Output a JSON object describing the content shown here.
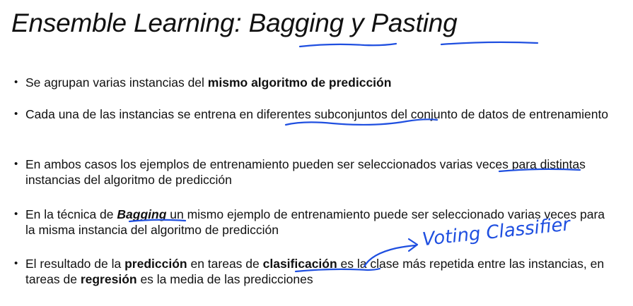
{
  "title": {
    "part1": "Ensemble Learning",
    "sep": ": ",
    "part2": "Bagging",
    "mid": " y ",
    "part3": "Pasting"
  },
  "bullets": [
    {
      "a": "Se agrupan varias instancias del ",
      "b": "mismo algoritmo de predicción"
    },
    {
      "a": "Cada una de las instancias se entrena en diferentes subconjuntos del conjunto de datos de entrenamiento"
    },
    {
      "a": "En ambos casos los ejemplos de entrenamiento pueden ser seleccionados varias veces para distintas instancias del algoritmo de predicción"
    },
    {
      "a": "En la técnica de ",
      "b": "Bagging",
      "c": " un mismo ejemplo de entrenamiento puede ser seleccionado varias veces para la misma instancia del algoritmo de predicción"
    },
    {
      "a": "El resultado de la ",
      "b": "predicción",
      "c": " en tareas de ",
      "d": "clasificación",
      "e": " es la clase más repetida entre las instancias, en tareas de ",
      "f": "regresión",
      "g": " es la media de las predicciones"
    }
  ],
  "annotation": {
    "handwritten": "Voting Classifier",
    "ink_color": "#1f4fe0"
  }
}
